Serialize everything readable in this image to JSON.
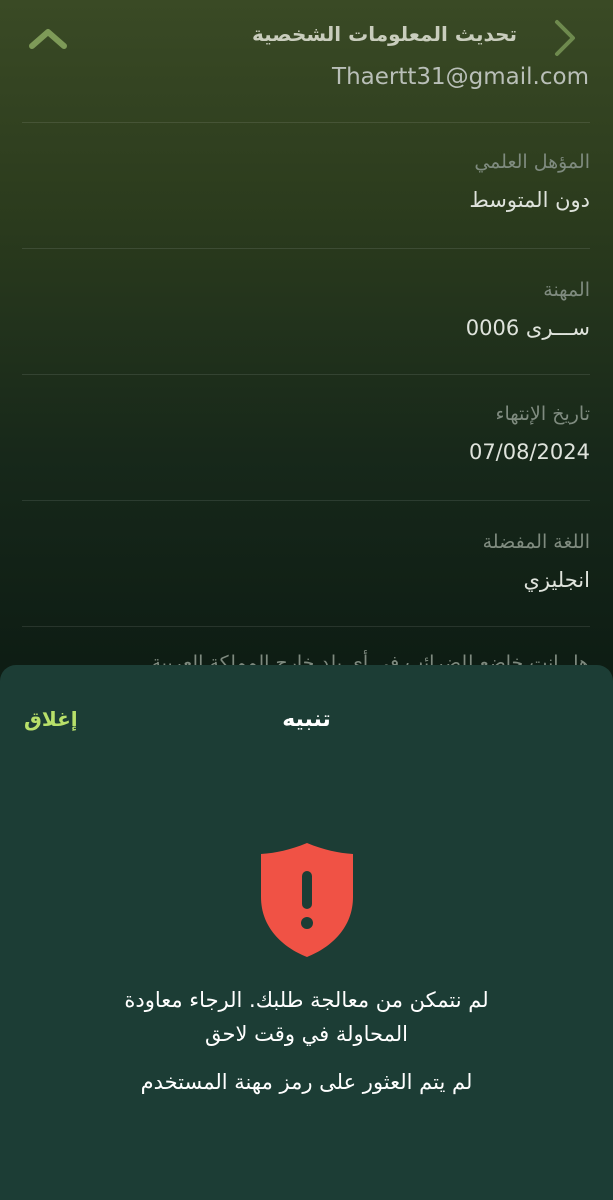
{
  "header": {
    "title": "تحديث المعلومات الشخصية",
    "back_icon": "chevron-right-icon",
    "collapse_icon": "chevron-up-icon"
  },
  "fields": {
    "email": "Thaertt31@gmail.com",
    "qualification": {
      "label": "المؤهل العلمي",
      "value": "دون المتوسط"
    },
    "profession": {
      "label": "المهنة",
      "value": "ســـرى 0006"
    },
    "expiry": {
      "label": "تاريخ الإنتهاء",
      "value": "07/08/2024"
    },
    "language": {
      "label": "اللغة المفضلة",
      "value": "انجليزي"
    },
    "partial_question": "هل انت خاضع للضرائب في أي بلد خارج المملكة العربية"
  },
  "alert": {
    "title": "تنبيه",
    "close_label": "إغلاق",
    "icon": "shield-alert-icon",
    "message_line1": "لم نتمكن من معالجة طلبك. الرجاء معاودة",
    "message_line2": "المحاولة في وقت لاحق",
    "message_detail": "لم يتم العثور على رمز مهنة المستخدم"
  },
  "colors": {
    "accent": "#b8e06a",
    "sheet_bg": "#1c3d35",
    "alert_red": "#f05245"
  }
}
